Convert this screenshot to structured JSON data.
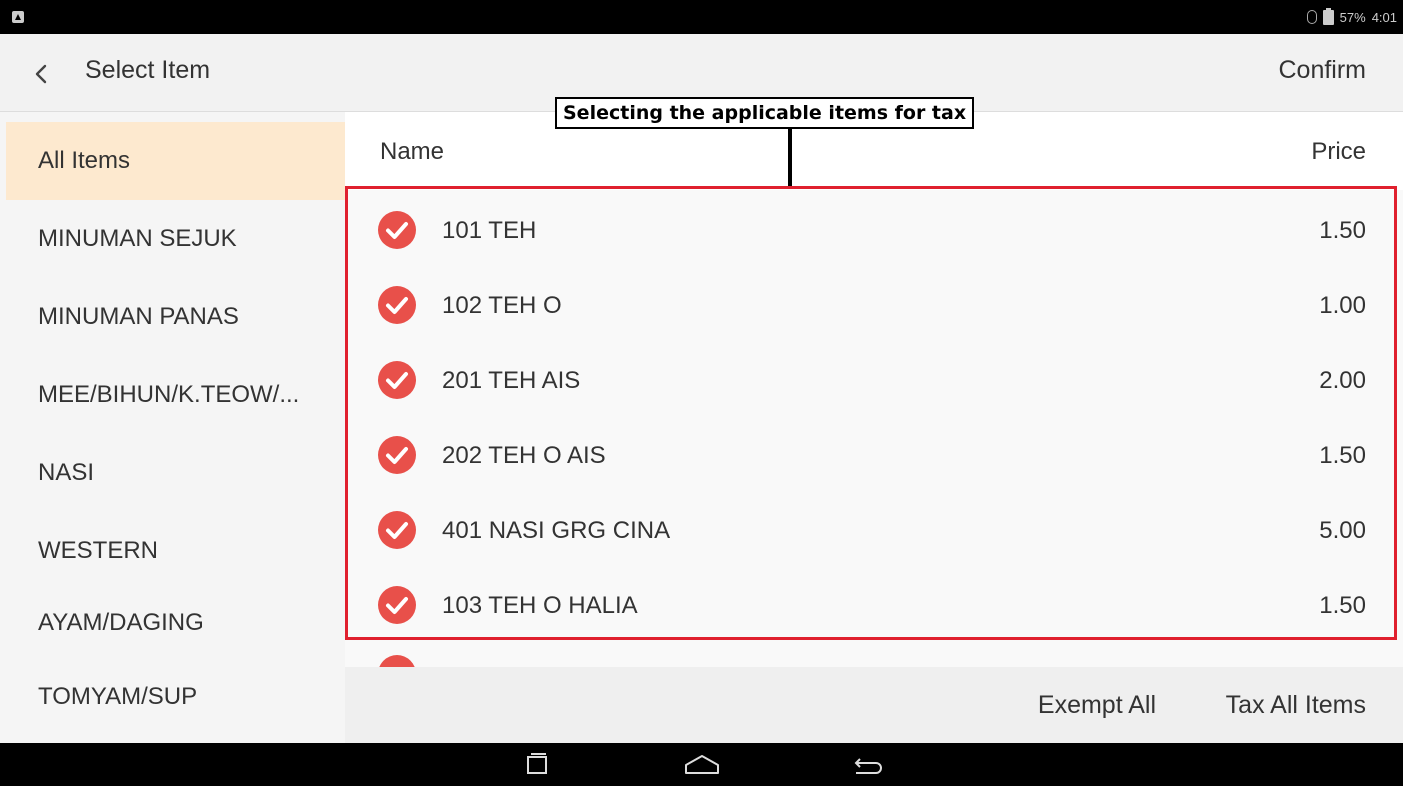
{
  "status_bar": {
    "battery": "57%",
    "time": "4:01"
  },
  "header": {
    "title": "Select Item",
    "confirm_label": "Confirm"
  },
  "sidebar": {
    "items": [
      {
        "label": "All Items",
        "active": true
      },
      {
        "label": "MINUMAN SEJUK"
      },
      {
        "label": "MINUMAN PANAS"
      },
      {
        "label": "MEE/BIHUN/K.TEOW/..."
      },
      {
        "label": "NASI"
      },
      {
        "label": "WESTERN"
      },
      {
        "label": "AYAM/DAGING"
      },
      {
        "label": "TOMYAM/SUP"
      }
    ]
  },
  "main": {
    "columns": {
      "name": "Name",
      "price": "Price"
    },
    "items": [
      {
        "name": "101 TEH",
        "price": "1.50",
        "checked": true
      },
      {
        "name": "102 TEH O",
        "price": "1.00",
        "checked": true
      },
      {
        "name": "201 TEH AIS",
        "price": "2.00",
        "checked": true
      },
      {
        "name": "202 TEH O AIS",
        "price": "1.50",
        "checked": true
      },
      {
        "name": "401 NASI GRG CINA",
        "price": "5.00",
        "checked": true
      },
      {
        "name": "103 TEH O HALIA",
        "price": "1.50",
        "checked": true
      }
    ],
    "footer": {
      "exempt_all": "Exempt All",
      "tax_all": "Tax All Items"
    }
  },
  "annotation": {
    "label": "Selecting the applicable items for tax"
  },
  "colors": {
    "check": "#e8504a",
    "annotation": "#e0202e",
    "active_category": "#fde9cf"
  }
}
